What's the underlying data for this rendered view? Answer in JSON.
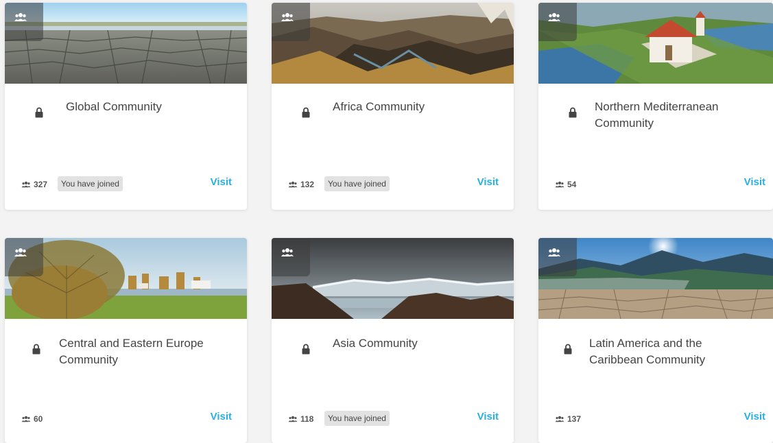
{
  "colors": {
    "accent": "#2ab0e0",
    "title_text": "#444444",
    "badge_bg": "#e2e2e2"
  },
  "icons": {
    "group": "group-icon",
    "lock": "lock-icon",
    "members": "members-icon"
  },
  "cards": [
    {
      "title": "Global Community",
      "members": "327",
      "joined": "You have joined",
      "visit": "Visit",
      "image": "cracked-dry-lakebed"
    },
    {
      "title": "Africa Community",
      "members": "132",
      "joined": "You have joined",
      "visit": "Visit",
      "image": "canyon-aerial"
    },
    {
      "title": "Northern Mediterranean Community",
      "members": "54",
      "joined": "",
      "visit": "Visit",
      "image": "chapel-wetland"
    },
    {
      "title": "Central and Eastern Europe Community",
      "members": "60",
      "joined": "",
      "visit": "Visit",
      "image": "lake-meadow-tree"
    },
    {
      "title": "Asia Community",
      "members": "118",
      "joined": "You have joined",
      "visit": "Visit",
      "image": "mountains-storm-sky"
    },
    {
      "title": "Latin America and the Caribbean Community",
      "members": "137",
      "joined": "",
      "visit": "Visit",
      "image": "mountain-sunburst-cracked"
    }
  ]
}
